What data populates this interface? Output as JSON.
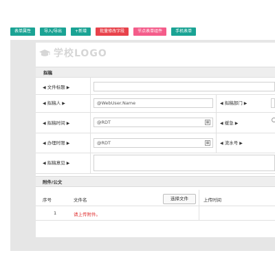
{
  "toolbar": {
    "buttons": [
      {
        "label": "表单属性"
      },
      {
        "label": "导入/导出"
      },
      {
        "label": "+新增"
      },
      {
        "label": "批量修改字段"
      },
      {
        "label": "节点表单组件"
      },
      {
        "label": "手机表单"
      }
    ]
  },
  "logo": {
    "text": "学校LOGO"
  },
  "sections": {
    "main": "拟稿",
    "attachments": "附件/公文"
  },
  "fields": {
    "title_label": "文件标题",
    "drafter_label": "拟稿人",
    "drafter_value": "@WebUser.Name",
    "dept_label": "拟稿部门",
    "draft_time_label": "拟稿时间",
    "draft_time_value": "@RDT",
    "urgency_label": "缓急",
    "handle_time_label": "办理时限",
    "handle_time_value": "@RDT",
    "serial_label": "流水号",
    "opinion_label": "拟稿意见"
  },
  "attach_table": {
    "headers": [
      "序号",
      "文件名",
      "上传时间"
    ],
    "upload_button": "选择文件",
    "row_index": "1",
    "hint": "请上传附件。"
  },
  "colors": {
    "green": "#1aa394",
    "red": "#e8424b",
    "pink": "#f45c8a"
  }
}
